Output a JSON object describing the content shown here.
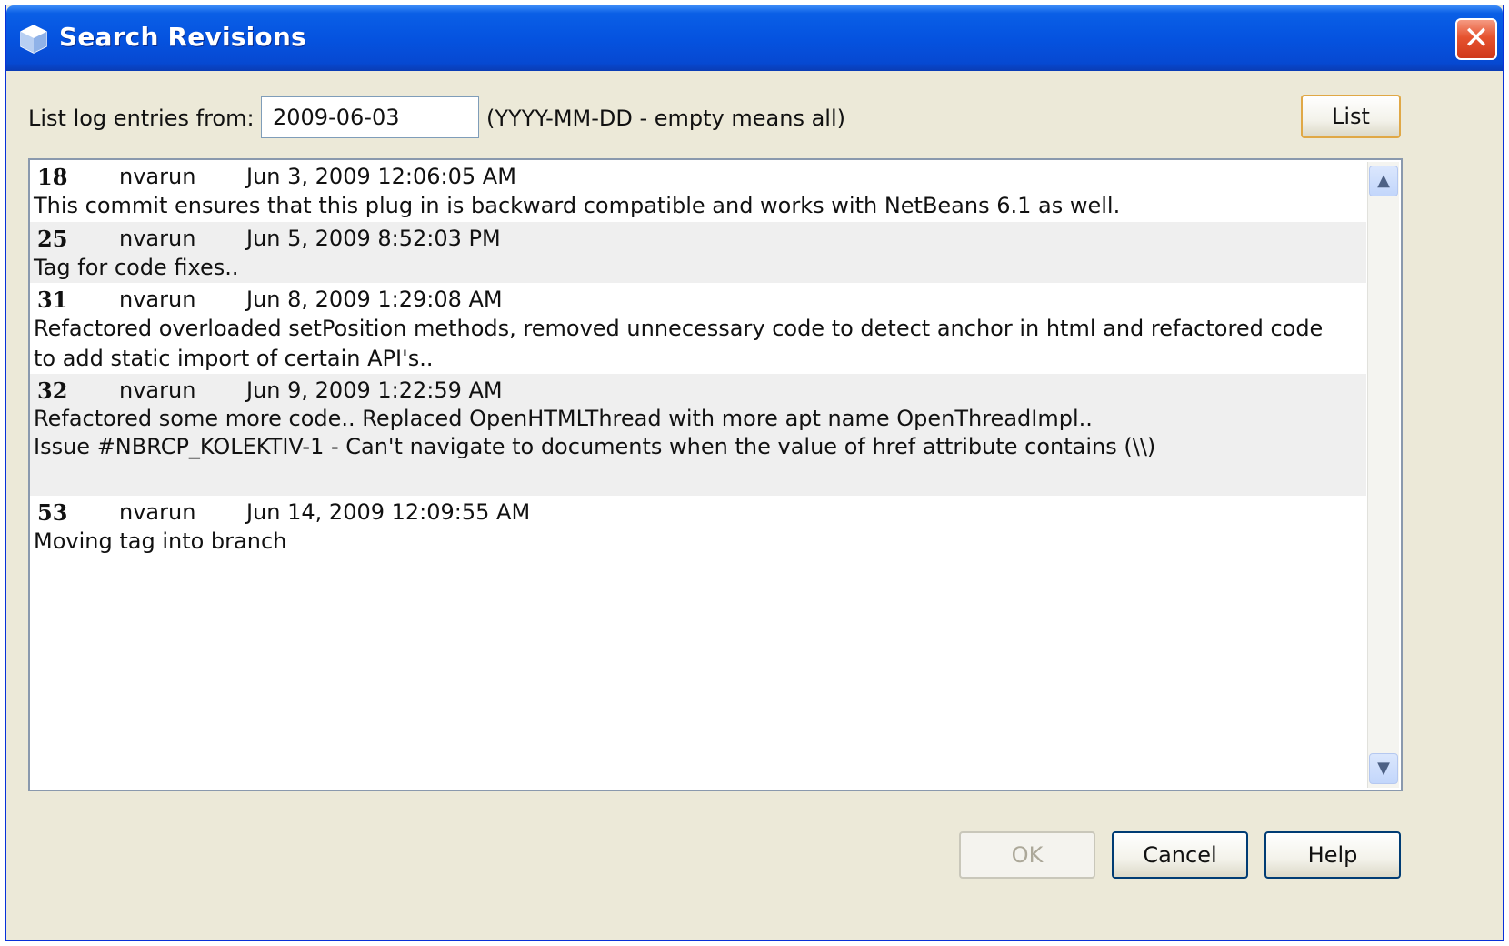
{
  "window": {
    "title": "Search Revisions",
    "close_glyph": "✕"
  },
  "filter": {
    "label": "List log entries from:",
    "date_value": "2009-06-03",
    "hint": "(YYYY-MM-DD - empty means all)",
    "list_label": "List"
  },
  "log": {
    "entries": [
      {
        "revision": "18",
        "author": "nvarun",
        "date": "Jun 3, 2009 12:06:05 AM",
        "message": "This commit ensures that this plug in is backward compatible and works with NetBeans 6.1 as well.",
        "message2": ""
      },
      {
        "revision": "25",
        "author": "nvarun",
        "date": "Jun 5, 2009 8:52:03 PM",
        "message": "Tag for code fixes..",
        "message2": ""
      },
      {
        "revision": "31",
        "author": "nvarun",
        "date": "Jun 8, 2009 1:29:08 AM",
        "message": "Refactored overloaded setPosition methods, removed unnecessary code to detect anchor in html and refactored code to add static import of certain API's..",
        "message2": ""
      },
      {
        "revision": "32",
        "author": "nvarun",
        "date": "Jun 9, 2009 1:22:59 AM",
        "message": "Refactored some more code.. Replaced OpenHTMLThread with more apt name OpenThreadImpl..",
        "message2": "Issue #NBRCP_KOLEKTIV-1 - Can't navigate to documents when the value of href attribute contains (\\\\)"
      },
      {
        "revision": "53",
        "author": "nvarun",
        "date": "Jun 14, 2009 12:09:55 AM",
        "message": "Moving tag into branch",
        "message2": ""
      }
    ]
  },
  "scrollbar": {
    "up_glyph": "▲",
    "down_glyph": "▼"
  },
  "buttons": {
    "ok": "OK",
    "cancel": "Cancel",
    "help": "Help"
  },
  "colors": {
    "titlebar": "#0553e0",
    "dialog_bg": "#ece9d8",
    "alt_row": "#efefef",
    "focus_border": "#e0a846"
  }
}
